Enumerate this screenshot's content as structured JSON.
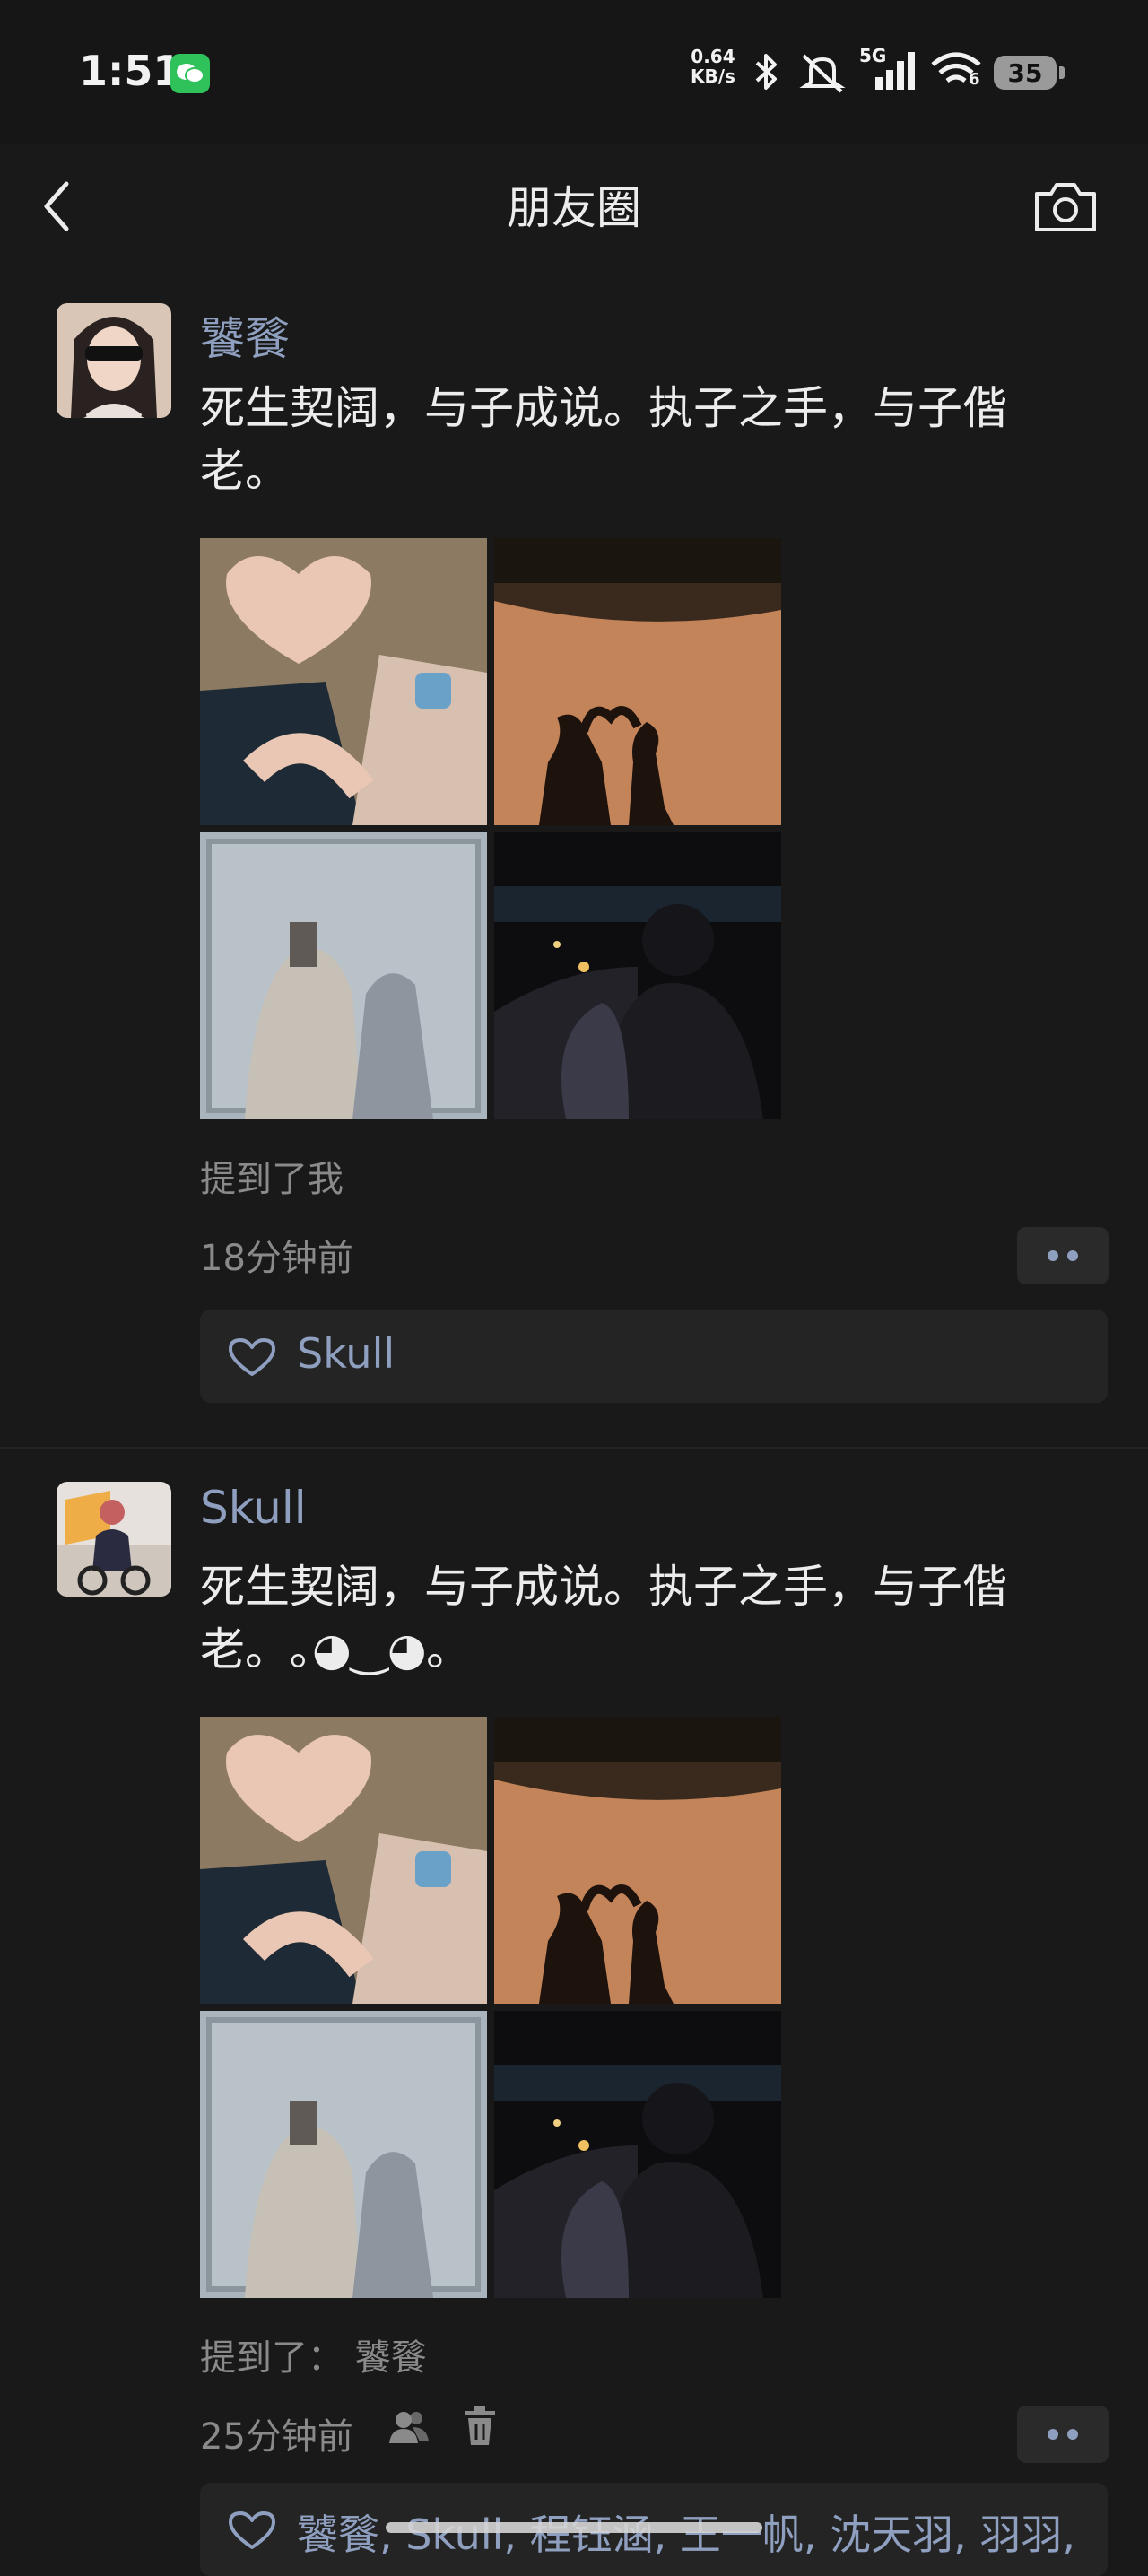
{
  "status_bar": {
    "time": "1:51",
    "net_speed_value": "0.64",
    "net_speed_unit": "KB/s",
    "signal_type": "5G",
    "wifi_level": "6",
    "battery": "35"
  },
  "nav": {
    "title": "朋友圈"
  },
  "posts": [
    {
      "author": "饕餮",
      "text": "死生契阔，与子成说。执子之手，与子偕老。",
      "mention": "提到了我",
      "mention_prefix": "",
      "time": "18分钟前",
      "likes": "Skull"
    },
    {
      "author": "Skull",
      "text": "死生契阔，与子成说。执子之手，与子偕老。｡◕‿◕｡",
      "mention_prefix": "提到了：",
      "mention": "饕餮",
      "time": "25分钟前",
      "likes": "饕餮, Skull, 程钰涵, 王一帆, 沈天羽, 羽羽,"
    }
  ],
  "colors": {
    "background": "#191919",
    "name_blue": "#8f9fbf",
    "text": "#ececec",
    "meta_gray": "#8a8a8a"
  }
}
